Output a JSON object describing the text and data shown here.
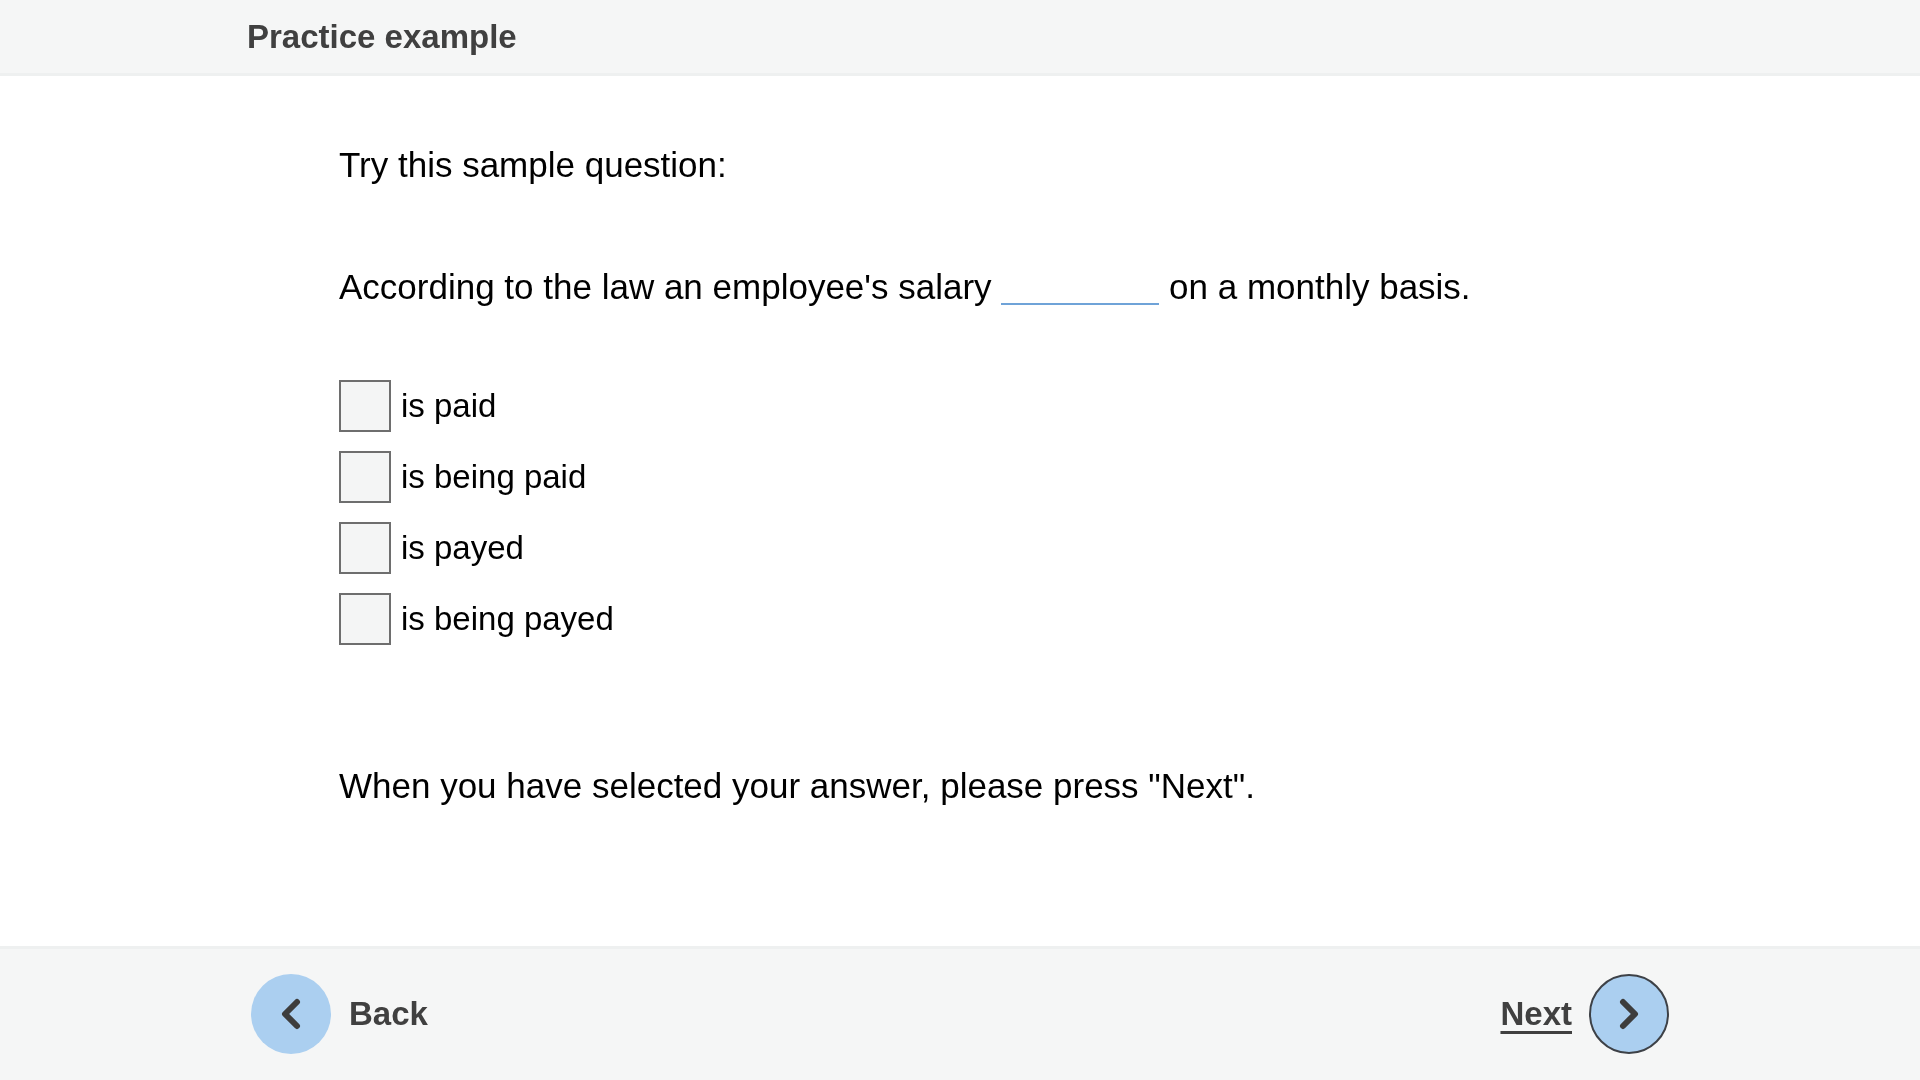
{
  "header": {
    "title": "Practice example"
  },
  "intro": "Try this sample question:",
  "question": {
    "text_before": "According to the law an employee's salary",
    "text_after": "on a monthly basis."
  },
  "options": [
    {
      "label": "is paid",
      "checked": false
    },
    {
      "label": "is being paid",
      "checked": false
    },
    {
      "label": "is payed",
      "checked": false
    },
    {
      "label": "is being payed",
      "checked": false
    }
  ],
  "instruction": "When you have selected your answer, please press \"Next\".",
  "navigation": {
    "back": {
      "label": "Back",
      "focused": false
    },
    "next": {
      "label": "Next",
      "focused": true
    }
  }
}
